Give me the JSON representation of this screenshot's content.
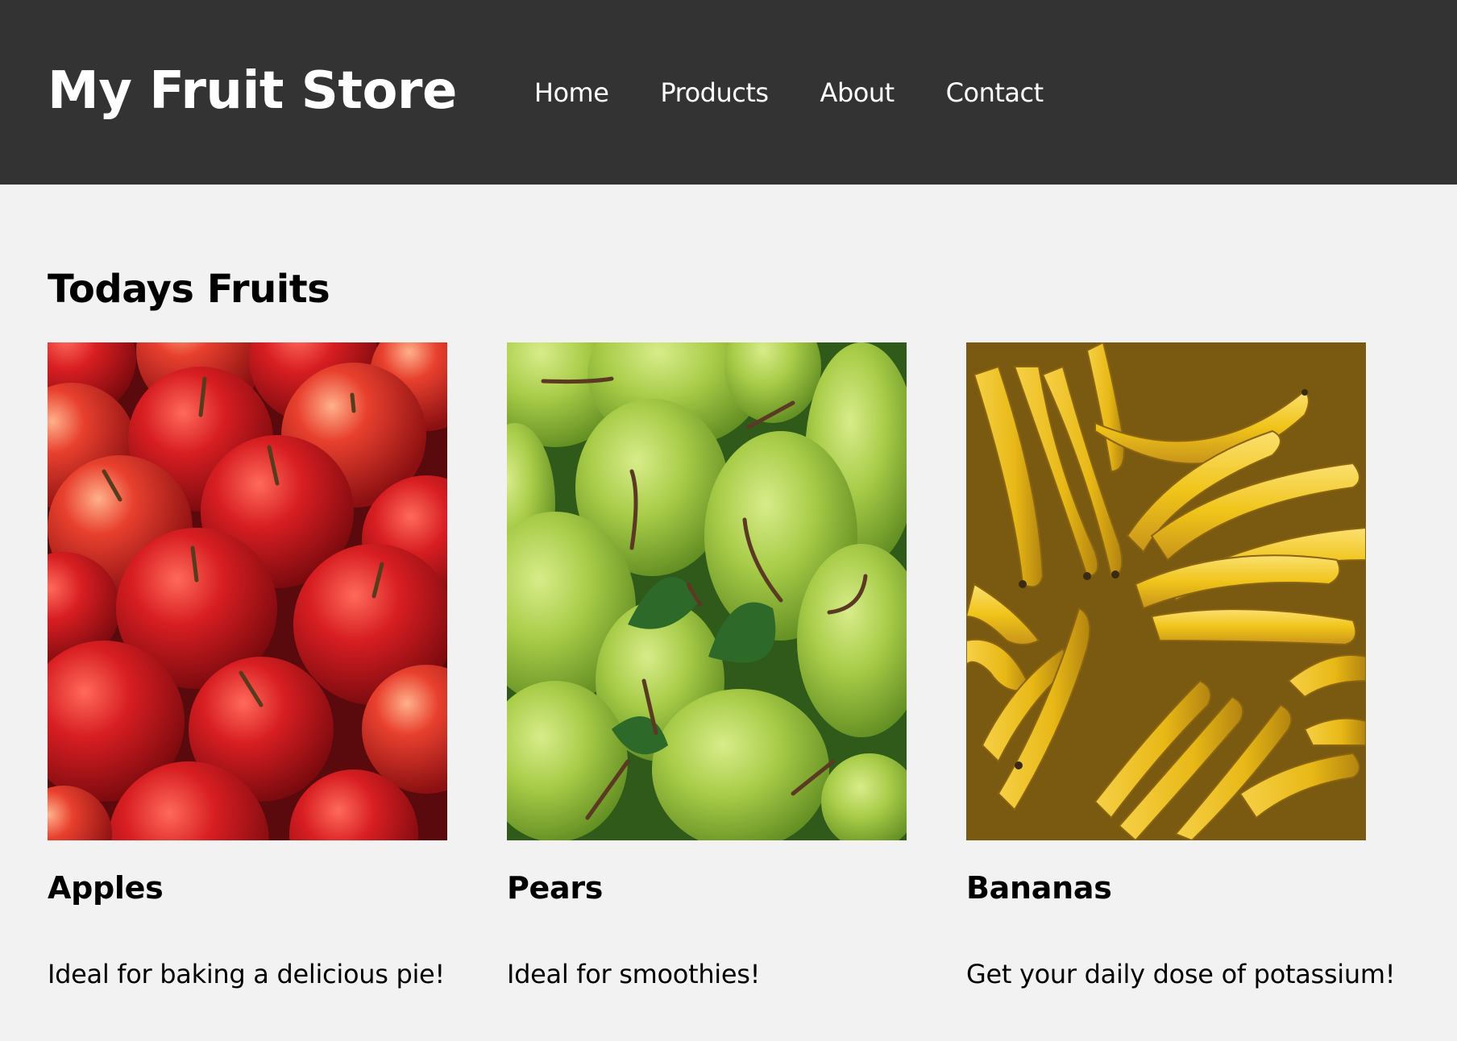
{
  "header": {
    "brand": "My Fruit Store",
    "nav": [
      "Home",
      "Products",
      "About",
      "Contact"
    ]
  },
  "main": {
    "section_title": "Todays Fruits",
    "products": [
      {
        "name": "Apples",
        "description": "Ideal for baking a delicious pie!",
        "image": "apples-photo"
      },
      {
        "name": "Pears",
        "description": "Ideal for smoothies!",
        "image": "pears-photo"
      },
      {
        "name": "Bananas",
        "description": "Get your daily dose of potassium!",
        "image": "bananas-photo"
      }
    ]
  },
  "colors": {
    "header_bg": "#333333",
    "page_bg": "#f2f2f2",
    "apple": "#c8161d",
    "pear": "#a8cc48",
    "banana": "#f0c419"
  }
}
